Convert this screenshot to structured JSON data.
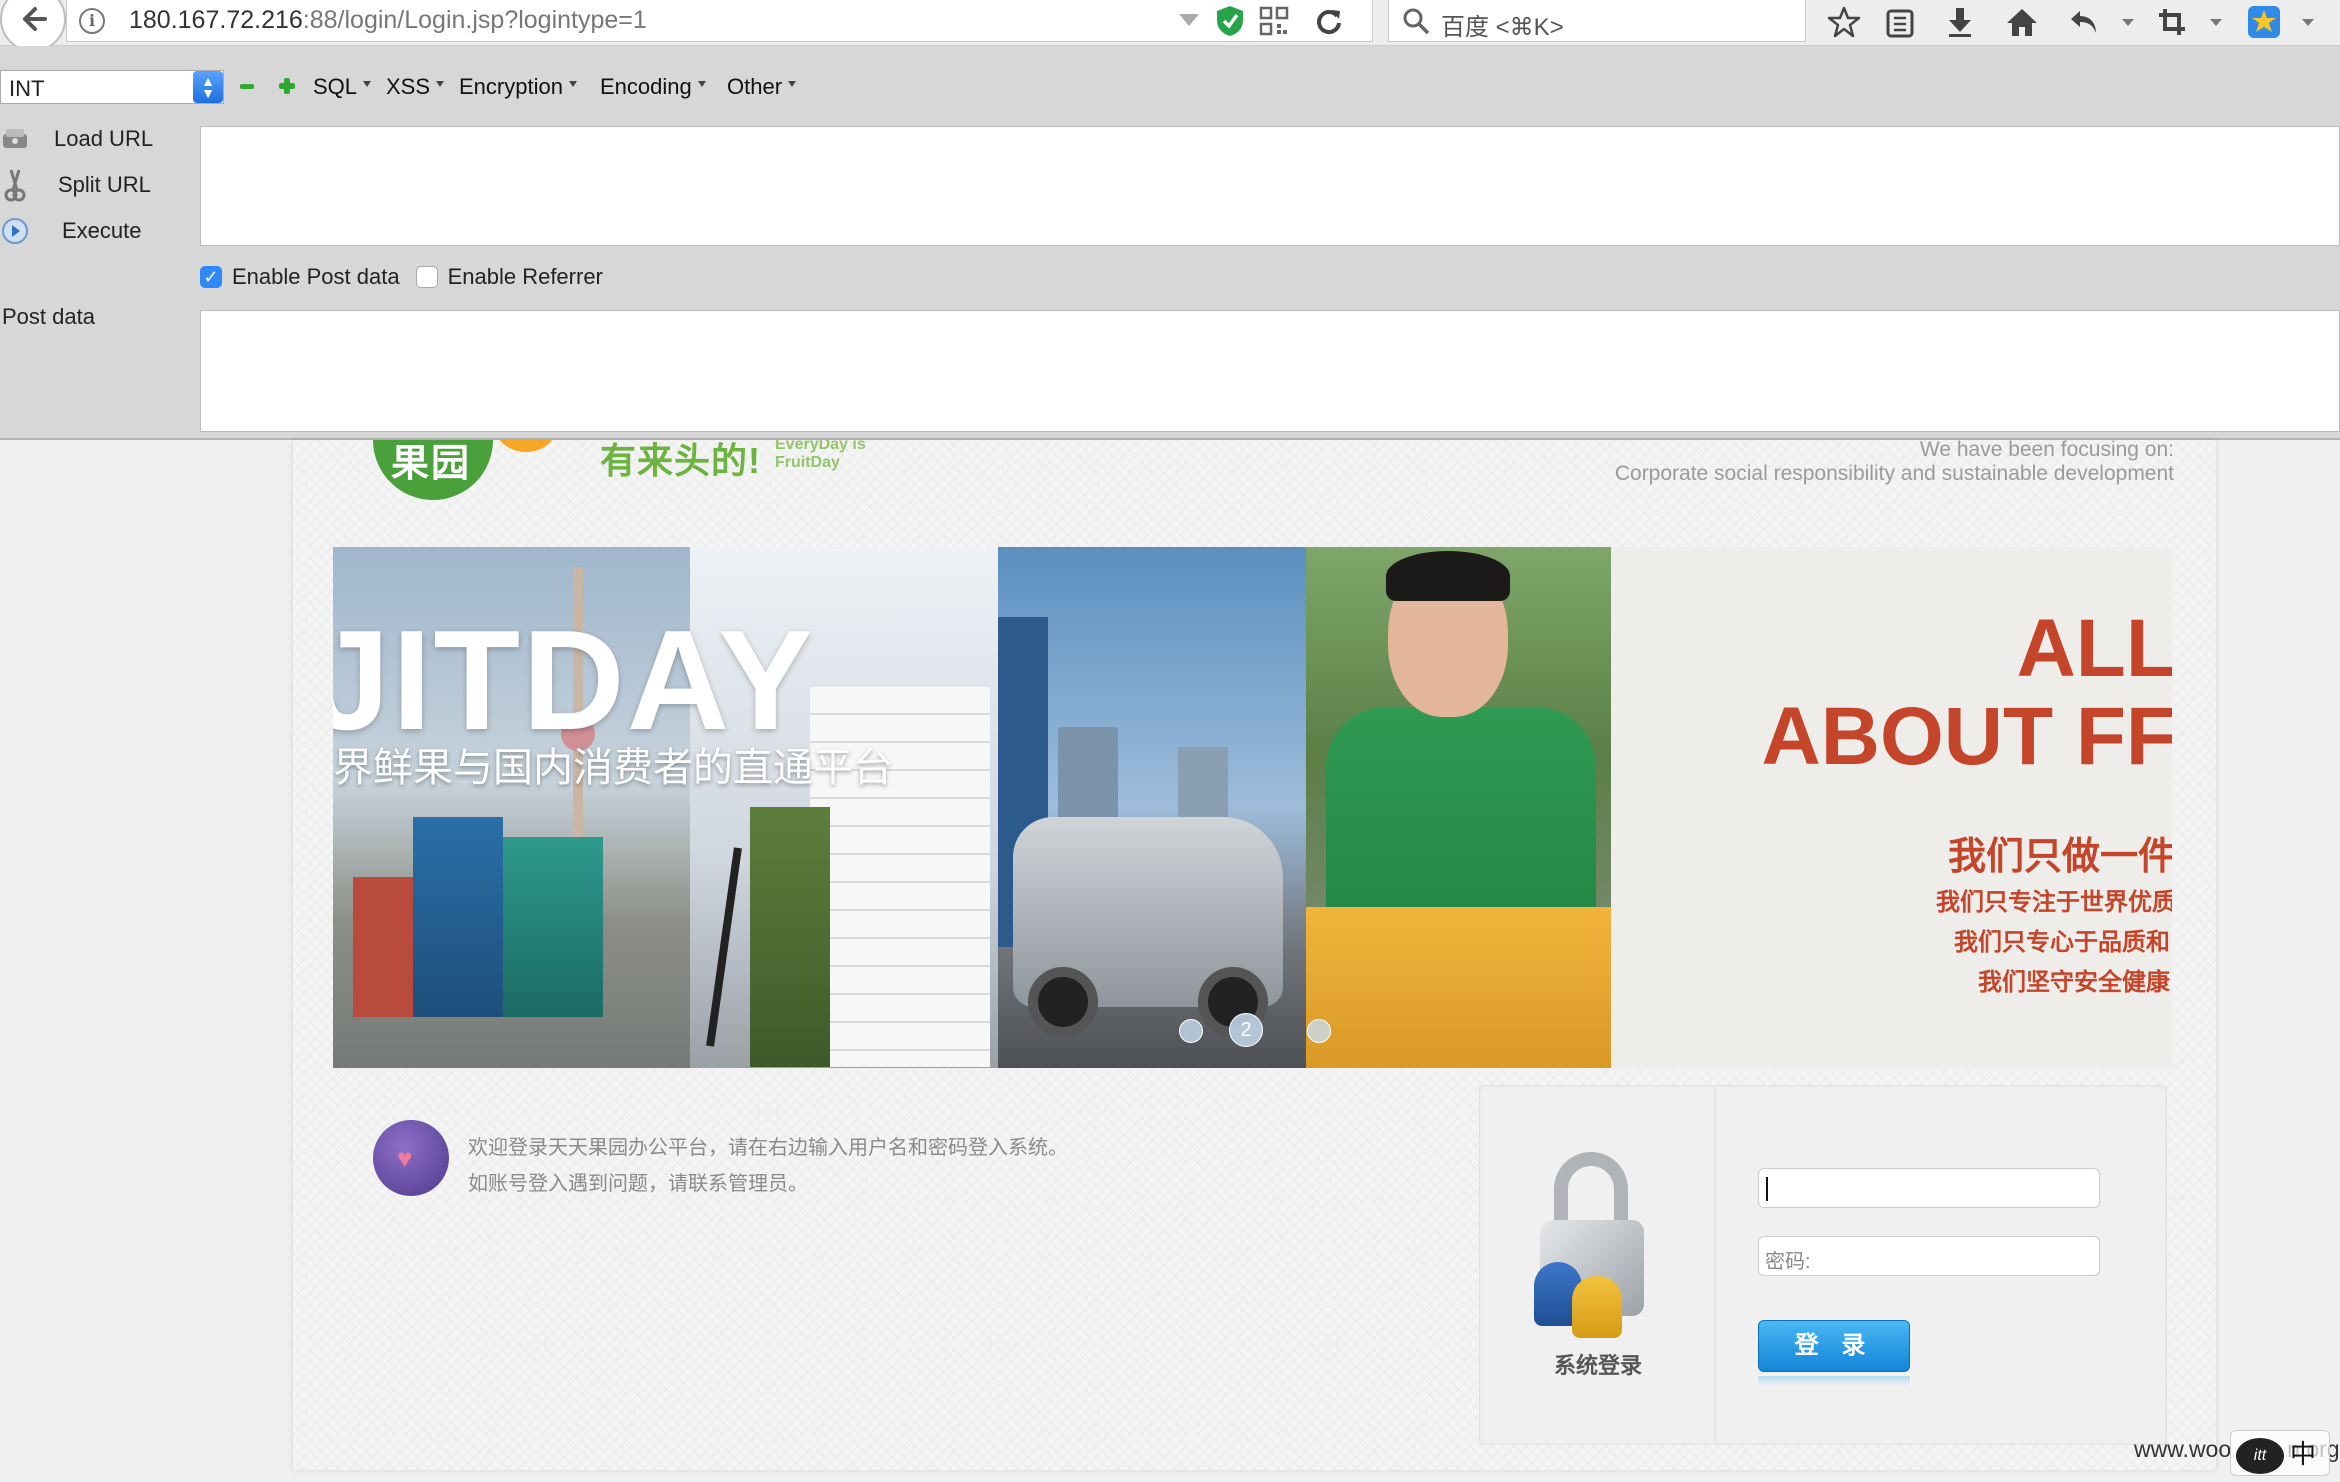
{
  "browser": {
    "url_host": "180.167.72.216",
    "url_rest": ":88/login/Login.jsp?logintype=1",
    "search_placeholder": "百度 <⌘K>"
  },
  "hackbar": {
    "select_value": "INT",
    "menus": [
      "SQL",
      "XSS",
      "Encryption",
      "Encoding",
      "Other"
    ],
    "load_url": "Load URL",
    "split_url": "Split URL",
    "execute": "Execute",
    "enable_post": "Enable Post data",
    "enable_post_checked": true,
    "enable_referrer": "Enable Referrer",
    "enable_referrer_checked": false,
    "post_data_label": "Post data"
  },
  "page": {
    "logo_text": "果园",
    "slogan": "有来头的!",
    "slogan_en_1": "EveryDay is",
    "slogan_en_2": "FruitDay",
    "focus_line1": "We have been focusing on:",
    "focus_line2": "Corporate social responsibility and sustainable development",
    "banner": {
      "title": "JITDAY",
      "subtitle": "界鲜果与国内消费者的直通平台",
      "right_line1": "ALL",
      "right_line2": "ABOUT FF",
      "right_cn": "我们只做一件",
      "right_cn_1": "我们只专注于世界优质",
      "right_cn_2": "我们只专心于品质和",
      "right_cn_3": "我们坚守安全健康",
      "active_slide": "2"
    },
    "welcome_line1": "欢迎登录天天果园办公平台，请在右边输入用户名和密码登入系统。",
    "welcome_line2": "如账号登入遇到问题，请联系管理员。",
    "login_caption": "系统登录",
    "password_placeholder": "密码:",
    "login_button": "登 录"
  },
  "watermark": {
    "text": "www.woo",
    "text_tail": "n.org",
    "badge": "itt",
    "ime": "中"
  }
}
